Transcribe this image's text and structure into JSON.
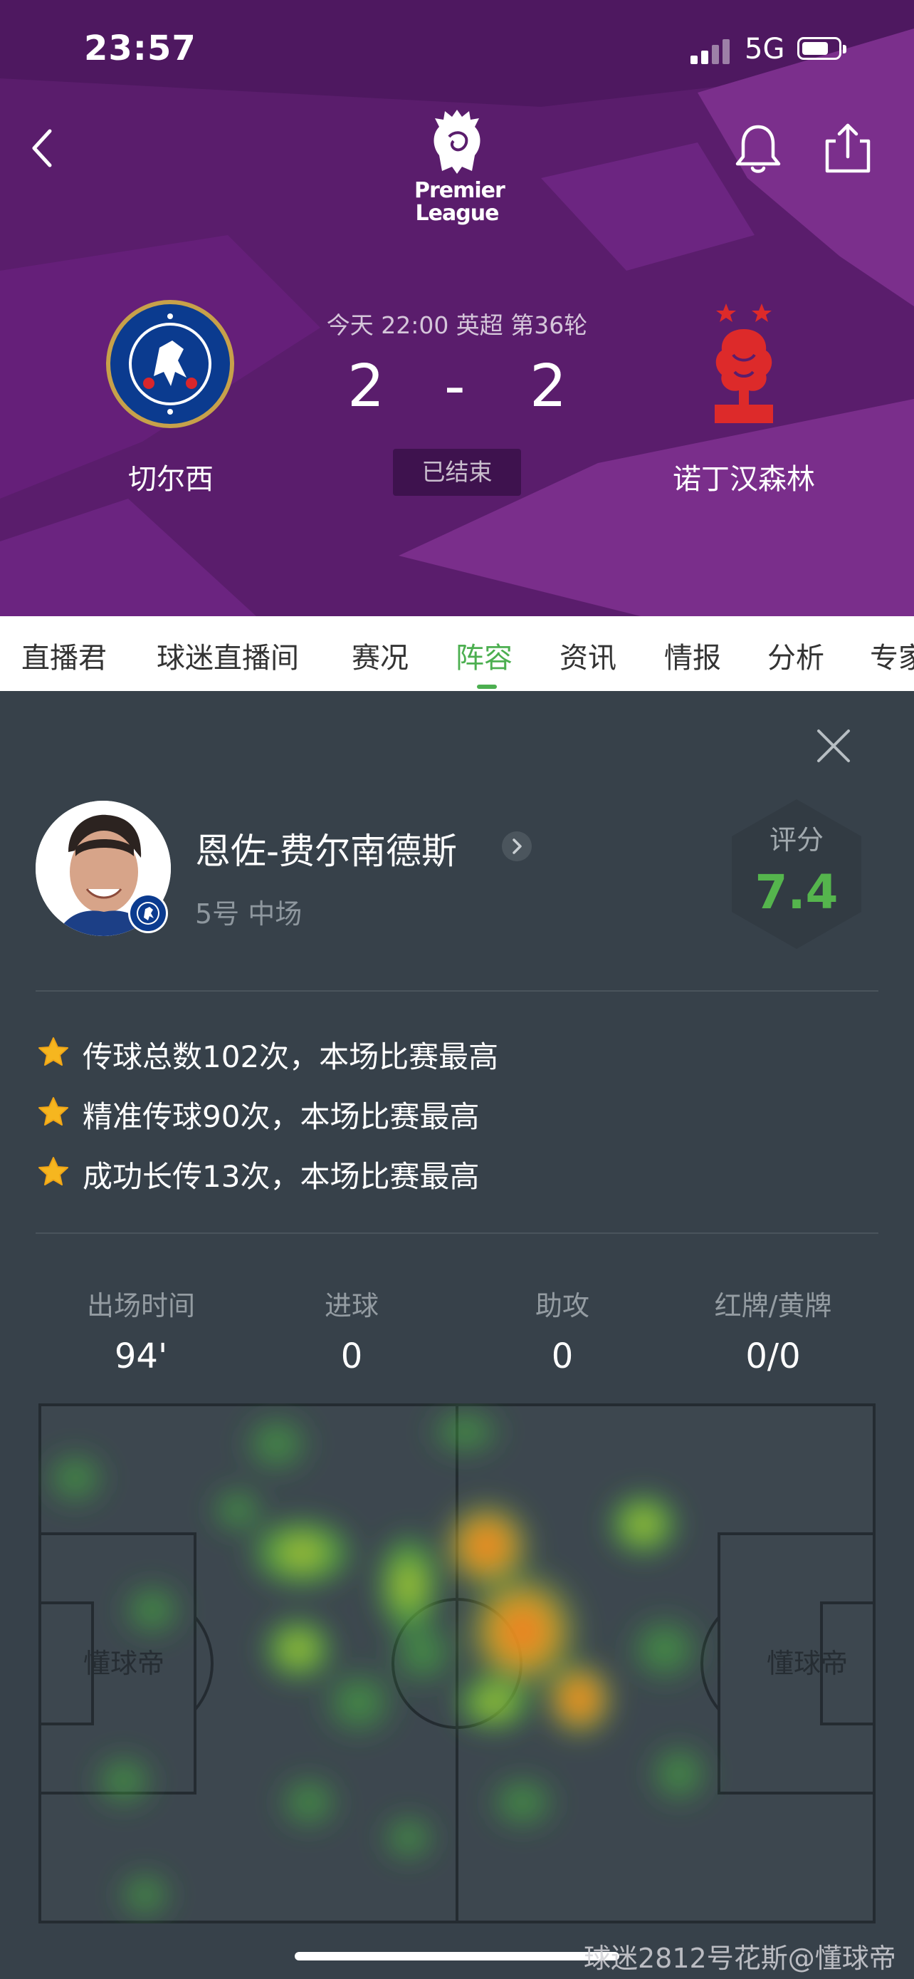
{
  "status_bar": {
    "time": "23:57",
    "network": "5G"
  },
  "header": {
    "league_logo_text": [
      "Premier",
      "League"
    ],
    "match_info": "今天 22:00 英超 第36轮",
    "home_team": "切尔西",
    "away_team": "诺丁汉森林",
    "home_score": "2",
    "score_separator": "-",
    "away_score": "2",
    "status": "已结束",
    "colors": {
      "background": "#5b1f6e",
      "accent_shape": "#7a2f8a"
    },
    "icons": {
      "back": "back-arrow-icon",
      "bell": "bell-icon",
      "share": "share-icon"
    }
  },
  "tabs": [
    {
      "label": "直播君",
      "active": false
    },
    {
      "label": "球迷直播间",
      "active": false
    },
    {
      "label": "赛况",
      "active": false
    },
    {
      "label": "阵容",
      "active": true
    },
    {
      "label": "资讯",
      "active": false
    },
    {
      "label": "情报",
      "active": false
    },
    {
      "label": "分析",
      "active": false
    },
    {
      "label": "专家",
      "active": false
    }
  ],
  "player": {
    "name": "恩佐-费尔南德斯",
    "meta": "5号 中场",
    "rating_label": "评分",
    "rating": "7.4",
    "rating_color": "#55b54d"
  },
  "highlights": [
    "传球总数102次，本场比赛最高",
    "精准传球90次，本场比赛最高",
    "成功长传13次，本场比赛最高"
  ],
  "stats": [
    {
      "label": "出场时间",
      "value": "94'"
    },
    {
      "label": "进球",
      "value": "0"
    },
    {
      "label": "助攻",
      "value": "0"
    },
    {
      "label": "红牌/黄牌",
      "value": "0/0"
    }
  ],
  "pitch": {
    "left_label": "懂球帝",
    "right_label": "懂球帝"
  },
  "watermark": "球迷2812号花斯@懂球帝"
}
